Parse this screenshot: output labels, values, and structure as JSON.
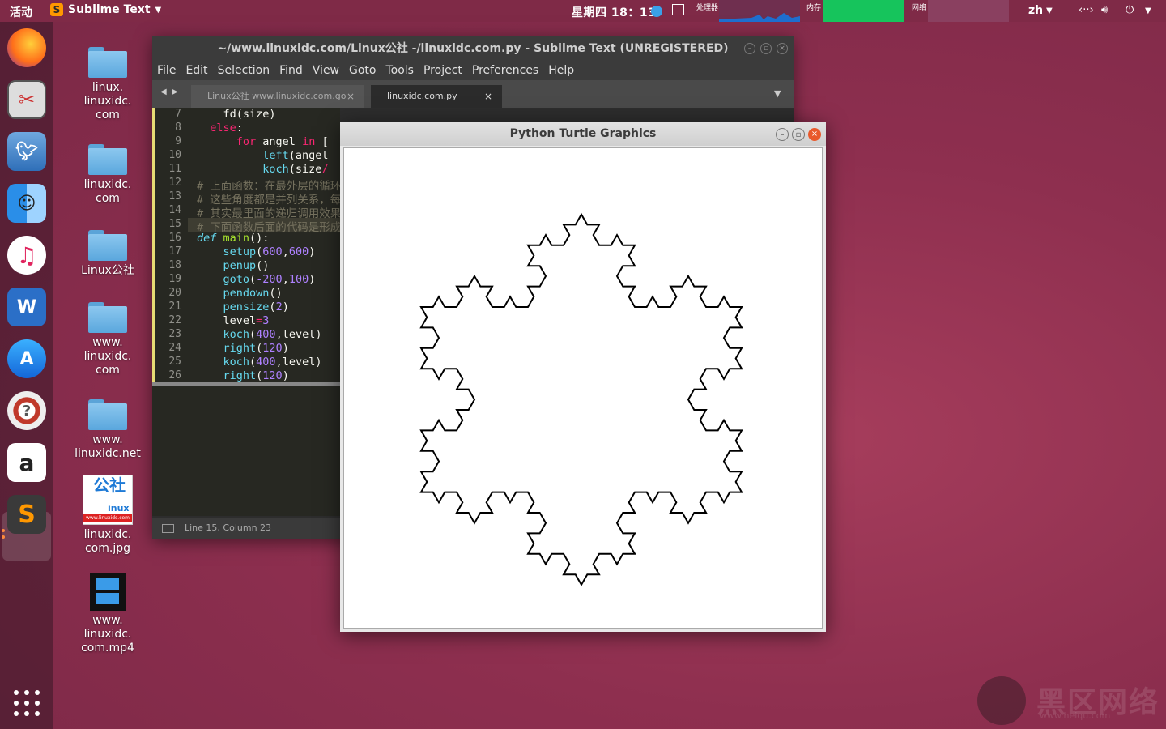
{
  "topbar": {
    "activities": "活动",
    "app_name": "Sublime Text",
    "clock": "星期四 18：13",
    "sysmon": {
      "cpu": "处理器",
      "mem": "内存",
      "net": "网络"
    },
    "lang": "zh"
  },
  "desktop": {
    "icons": [
      {
        "label": "linux.\nlinuxidc.\ncom"
      },
      {
        "label": "linuxidc.\ncom"
      },
      {
        "label": "Linux公社"
      },
      {
        "label": "www.\nlinuxidc.\ncom"
      },
      {
        "label": "www.\nlinuxidc.net"
      },
      {
        "label": "linuxidc.\ncom.jpg"
      },
      {
        "label": "www.\nlinuxidc.\ncom.mp4"
      }
    ],
    "jpg_thumb_text": "公社",
    "jpg_thumb_sub": "inux",
    "jpg_thumb_url": "www.linuxidc.com"
  },
  "sublime": {
    "title": "~/www.linuxidc.com/Linux公社 -/linuxidc.com.py - Sublime Text (UNREGISTERED)",
    "menu": [
      "File",
      "Edit",
      "Selection",
      "Find",
      "View",
      "Goto",
      "Tools",
      "Project",
      "Preferences",
      "Help"
    ],
    "tabs": [
      {
        "label": "Linux公社 www.linuxidc.com.go",
        "active": false
      },
      {
        "label": "linuxidc.com.py",
        "active": true
      }
    ],
    "status": "Line 15, Column 23",
    "line_numbers": [
      "7",
      "8",
      "9",
      "10",
      "11",
      "12",
      "13",
      "14",
      "15",
      "16",
      "17",
      "18",
      "19",
      "20",
      "21",
      "22",
      "23",
      "24",
      "25",
      "26"
    ]
  },
  "turtle": {
    "title": "Python Turtle Graphics"
  },
  "watermark": {
    "text": "黑区网络",
    "sub": "www.heiqu.com"
  }
}
